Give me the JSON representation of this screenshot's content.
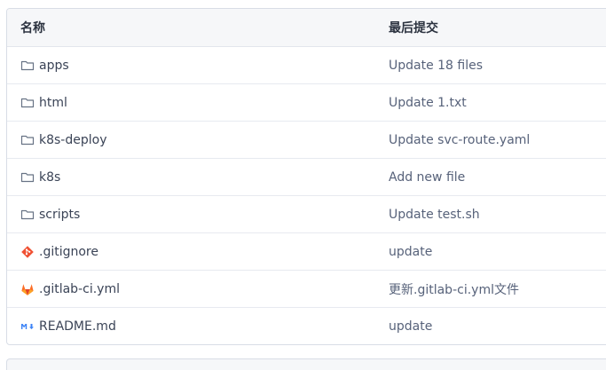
{
  "table": {
    "headers": {
      "name": "名称",
      "commit": "最后提交"
    },
    "rows": [
      {
        "name": "apps",
        "commit": "Update 18 files",
        "icon": "folder-icon"
      },
      {
        "name": "html",
        "commit": "Update 1.txt",
        "icon": "folder-icon"
      },
      {
        "name": "k8s-deploy",
        "commit": "Update svc-route.yaml",
        "icon": "folder-icon"
      },
      {
        "name": "k8s",
        "commit": "Add new file",
        "icon": "folder-icon"
      },
      {
        "name": "scripts",
        "commit": "Update test.sh",
        "icon": "folder-icon"
      },
      {
        "name": ".gitignore",
        "commit": "update",
        "icon": "git-icon"
      },
      {
        "name": ".gitlab-ci.yml",
        "commit": "更新.gitlab-ci.yml文件",
        "icon": "gitlab-icon"
      },
      {
        "name": "README.md",
        "commit": "update",
        "icon": "markdown-icon"
      }
    ]
  },
  "colors": {
    "border": "#d8dde6",
    "header_bg": "#f6f7f9",
    "text": "#3d4657",
    "git": "#f05133",
    "gitlab": "#fc6d26",
    "markdown": "#3b82f6"
  }
}
